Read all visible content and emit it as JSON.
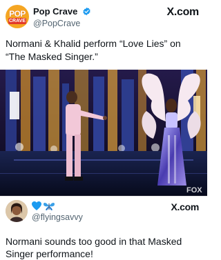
{
  "post": {
    "author": {
      "display_name": "Pop Crave",
      "handle": "@PopCrave",
      "avatar_text_top": "POP",
      "avatar_text_bottom": "CRAVE",
      "verified": true,
      "verified_color": "#1d9bf0"
    },
    "brand": "X.com",
    "text": "Normani & Khalid perform “Love Lies” on “The Masked Singer.”",
    "media": {
      "watermark": "FOX",
      "icon": "stage-performance-image"
    }
  },
  "reply": {
    "author": {
      "display_name_icons": [
        "blue-heart-icon",
        "butterfly-icon"
      ],
      "handle": "@flyingsavvy"
    },
    "brand": "X.com",
    "text": "Normani sounds too good in that Masked Singer performance!"
  },
  "colors": {
    "accent": "#1d9bf0",
    "muted_text": "#536471",
    "brand_orange": "#f5a623",
    "brand_red": "#e2392b"
  }
}
